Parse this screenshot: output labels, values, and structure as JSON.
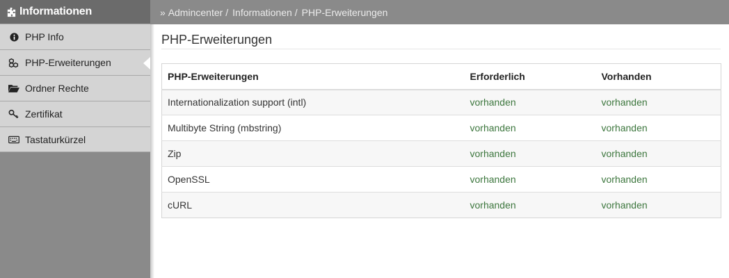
{
  "sidebar": {
    "header": {
      "icon": "puzzle-icon",
      "title": "Informationen"
    },
    "items": [
      {
        "label": "PHP Info",
        "icon": "info-circle-icon",
        "active": false
      },
      {
        "label": "PHP-Erweiterungen",
        "icon": "cubes-icon",
        "active": true
      },
      {
        "label": "Ordner Rechte",
        "icon": "folder-open-icon",
        "active": false
      },
      {
        "label": "Zertifikat",
        "icon": "key-icon",
        "active": false
      },
      {
        "label": "Tastaturkürzel",
        "icon": "keyboard-icon",
        "active": false
      }
    ]
  },
  "breadcrumb": {
    "prefix": "»",
    "items": [
      "Admincenter",
      "Informationen",
      "PHP-Erweiterungen"
    ],
    "separator": "/"
  },
  "main": {
    "title": "PHP-Erweiterungen",
    "table": {
      "headers": [
        "PHP-Erweiterungen",
        "Erforderlich",
        "Vorhanden"
      ],
      "rows": [
        [
          "Internationalization support (intl)",
          "vorhanden",
          "vorhanden"
        ],
        [
          "Multibyte String (mbstring)",
          "vorhanden",
          "vorhanden"
        ],
        [
          "Zip",
          "vorhanden",
          "vorhanden"
        ],
        [
          "OpenSSL",
          "vorhanden",
          "vorhanden"
        ],
        [
          "cURL",
          "vorhanden",
          "vorhanden"
        ]
      ]
    }
  },
  "colors": {
    "sidebar_bg": "#8a8a8a",
    "sidebar_header_bg": "#6b6b6b",
    "menu_item_bg": "#d4d4d4",
    "status_ok": "#3c763d"
  }
}
